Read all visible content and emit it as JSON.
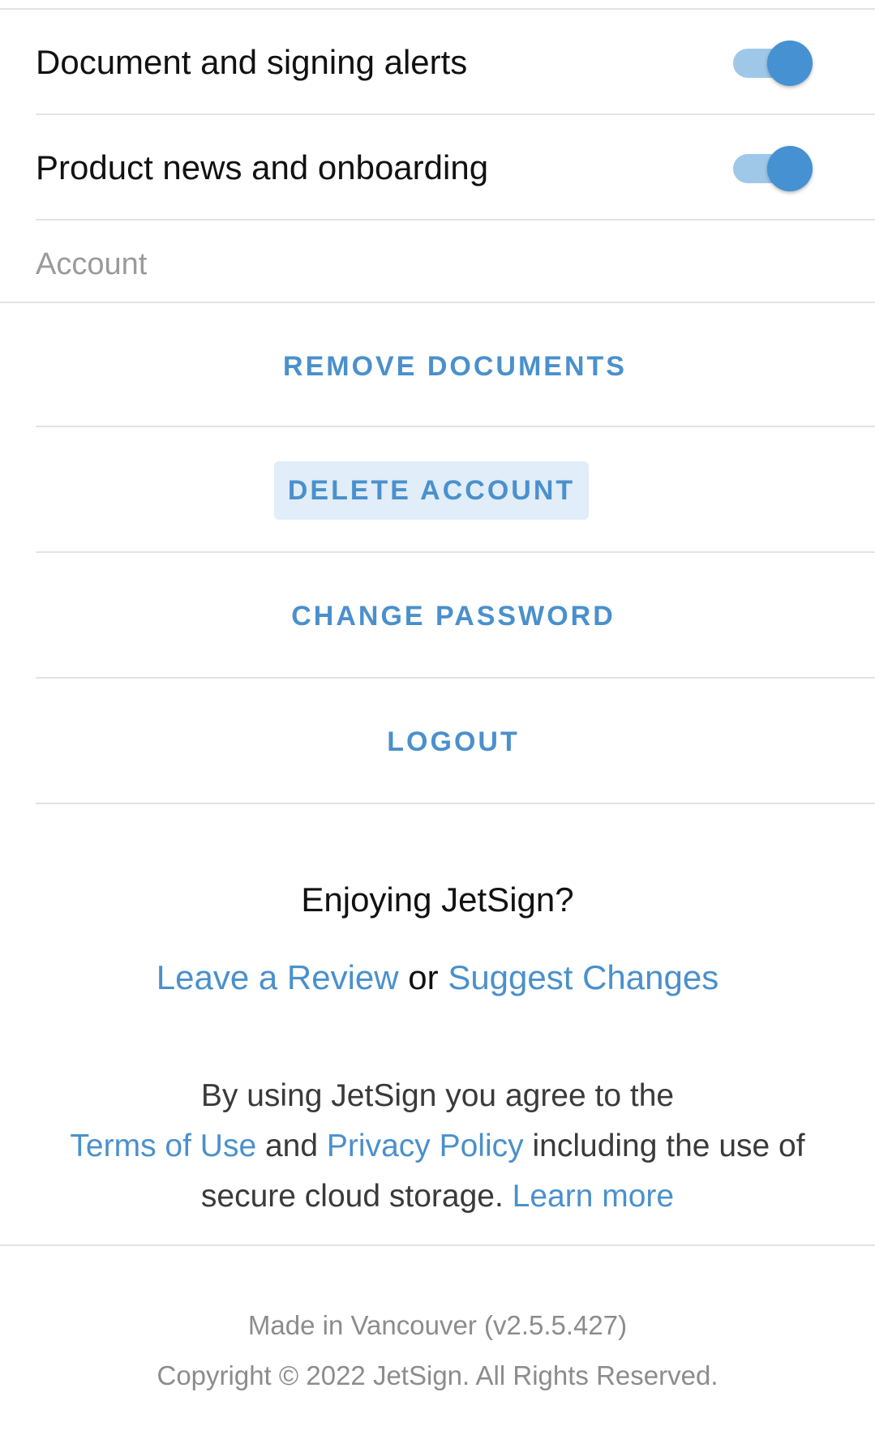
{
  "notifications": {
    "items": [
      {
        "label": "Document and signing alerts",
        "enabled": true
      },
      {
        "label": "Product news and onboarding",
        "enabled": true
      }
    ]
  },
  "account": {
    "header": "Account",
    "actions": [
      {
        "label": "REMOVE DOCUMENTS"
      },
      {
        "label": "DELETE ACCOUNT"
      },
      {
        "label": "CHANGE PASSWORD"
      },
      {
        "label": "LOGOUT"
      }
    ]
  },
  "feedback": {
    "title": "Enjoying JetSign?",
    "review_link": "Leave a Review",
    "connector": "or",
    "suggest_link": "Suggest Changes"
  },
  "legal": {
    "line1": "By using JetSign you agree to the",
    "terms_link": "Terms of Use",
    "and_text": "and",
    "privacy_link": "Privacy Policy",
    "line2_suffix": "including the use of",
    "line3_prefix": "secure cloud storage.",
    "learn_more_link": "Learn more"
  },
  "footer": {
    "made_in": "Made in Vancouver (v2.5.5.427)",
    "copyright": "Copyright © 2022 JetSign. All Rights Reserved."
  },
  "colors": {
    "accent": "#4a90cc",
    "toggle_knob": "#4591d2",
    "toggle_track": "#9fc8e8",
    "button_highlight": "#e1edf8",
    "divider": "#e3e3e3"
  }
}
